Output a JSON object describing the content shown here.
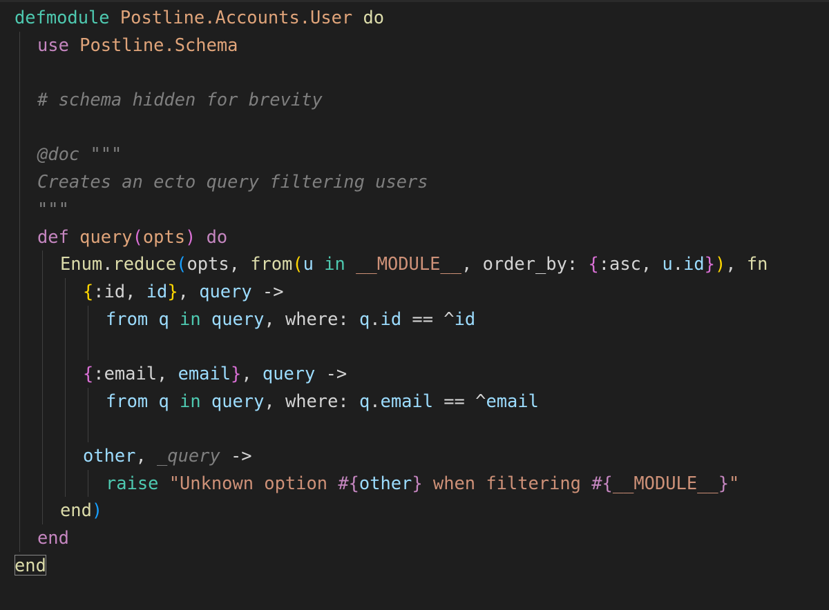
{
  "editor": {
    "lines": [
      {
        "indent": 0,
        "tokens": [
          {
            "t": "defmodule",
            "c": "kw-mod"
          },
          {
            "t": " ",
            "c": "plain"
          },
          {
            "t": "Postline.Accounts.User",
            "c": "mod"
          },
          {
            "t": " ",
            "c": "plain"
          },
          {
            "t": "do",
            "c": "kw-do-top"
          }
        ]
      },
      {
        "indent": 1,
        "tokens": [
          {
            "t": "use",
            "c": "kw"
          },
          {
            "t": " ",
            "c": "plain"
          },
          {
            "t": "Postline.Schema",
            "c": "mod"
          }
        ]
      },
      {
        "indent": 1,
        "tokens": []
      },
      {
        "indent": 1,
        "tokens": [
          {
            "t": "# schema hidden for brevity",
            "c": "comment"
          }
        ]
      },
      {
        "indent": 1,
        "tokens": []
      },
      {
        "indent": 1,
        "tokens": [
          {
            "t": "@doc",
            "c": "comment"
          },
          {
            "t": " \"\"\"",
            "c": "comment"
          }
        ]
      },
      {
        "indent": 1,
        "tokens": [
          {
            "t": "Creates an ecto query filtering users",
            "c": "comment"
          }
        ]
      },
      {
        "indent": 1,
        "tokens": [
          {
            "t": "\"\"\"",
            "c": "comment"
          }
        ]
      },
      {
        "indent": 1,
        "tokens": [
          {
            "t": "def",
            "c": "kw"
          },
          {
            "t": " ",
            "c": "plain"
          },
          {
            "t": "query",
            "c": "mod"
          },
          {
            "t": "(",
            "c": "brace-p"
          },
          {
            "t": "opts",
            "c": "mod"
          },
          {
            "t": ")",
            "c": "brace-p"
          },
          {
            "t": " ",
            "c": "plain"
          },
          {
            "t": "do",
            "c": "kw"
          }
        ]
      },
      {
        "indent": 2,
        "tokens": [
          {
            "t": "Enum",
            "c": "fn"
          },
          {
            "t": ".",
            "c": "plain"
          },
          {
            "t": "reduce",
            "c": "fn"
          },
          {
            "t": "(",
            "c": "brace-b"
          },
          {
            "t": "opts",
            "c": "plain"
          },
          {
            "t": ", ",
            "c": "plain"
          },
          {
            "t": "from",
            "c": "fn"
          },
          {
            "t": "(",
            "c": "brace-y"
          },
          {
            "t": "u",
            "c": "var"
          },
          {
            "t": " ",
            "c": "plain"
          },
          {
            "t": "in",
            "c": "kw-mod"
          },
          {
            "t": " ",
            "c": "plain"
          },
          {
            "t": "__MODULE__",
            "c": "str"
          },
          {
            "t": ", ",
            "c": "plain"
          },
          {
            "t": "order_by:",
            "c": "plain"
          },
          {
            "t": " ",
            "c": "plain"
          },
          {
            "t": "{",
            "c": "brace-p"
          },
          {
            "t": ":asc",
            "c": "plain"
          },
          {
            "t": ", ",
            "c": "plain"
          },
          {
            "t": "u",
            "c": "var"
          },
          {
            "t": ".",
            "c": "plain"
          },
          {
            "t": "id",
            "c": "var"
          },
          {
            "t": "}",
            "c": "brace-p"
          },
          {
            "t": ")",
            "c": "brace-y"
          },
          {
            "t": ", ",
            "c": "plain"
          },
          {
            "t": "fn",
            "c": "fn"
          }
        ]
      },
      {
        "indent": 3,
        "tokens": [
          {
            "t": "{",
            "c": "brace-y"
          },
          {
            "t": ":id",
            "c": "plain"
          },
          {
            "t": ", ",
            "c": "plain"
          },
          {
            "t": "id",
            "c": "var"
          },
          {
            "t": "}",
            "c": "brace-y"
          },
          {
            "t": ", ",
            "c": "plain"
          },
          {
            "t": "query",
            "c": "var"
          },
          {
            "t": " ->",
            "c": "plain"
          }
        ]
      },
      {
        "indent": 4,
        "tokens": [
          {
            "t": "from",
            "c": "var"
          },
          {
            "t": " ",
            "c": "plain"
          },
          {
            "t": "q",
            "c": "var"
          },
          {
            "t": " ",
            "c": "plain"
          },
          {
            "t": "in",
            "c": "kw-mod"
          },
          {
            "t": " ",
            "c": "plain"
          },
          {
            "t": "query",
            "c": "var"
          },
          {
            "t": ", ",
            "c": "plain"
          },
          {
            "t": "where:",
            "c": "plain"
          },
          {
            "t": " ",
            "c": "plain"
          },
          {
            "t": "q",
            "c": "var"
          },
          {
            "t": ".",
            "c": "plain"
          },
          {
            "t": "id",
            "c": "var"
          },
          {
            "t": " == ",
            "c": "plain"
          },
          {
            "t": "^",
            "c": "plain"
          },
          {
            "t": "id",
            "c": "var"
          }
        ]
      },
      {
        "indent": 4,
        "tokens": []
      },
      {
        "indent": 3,
        "tokens": [
          {
            "t": "{",
            "c": "brace-p"
          },
          {
            "t": ":email",
            "c": "plain"
          },
          {
            "t": ", ",
            "c": "plain"
          },
          {
            "t": "email",
            "c": "var"
          },
          {
            "t": "}",
            "c": "brace-p"
          },
          {
            "t": ", ",
            "c": "plain"
          },
          {
            "t": "query",
            "c": "var"
          },
          {
            "t": " ->",
            "c": "plain"
          }
        ]
      },
      {
        "indent": 4,
        "tokens": [
          {
            "t": "from",
            "c": "var"
          },
          {
            "t": " ",
            "c": "plain"
          },
          {
            "t": "q",
            "c": "var"
          },
          {
            "t": " ",
            "c": "plain"
          },
          {
            "t": "in",
            "c": "kw-mod"
          },
          {
            "t": " ",
            "c": "plain"
          },
          {
            "t": "query",
            "c": "var"
          },
          {
            "t": ", ",
            "c": "plain"
          },
          {
            "t": "where:",
            "c": "plain"
          },
          {
            "t": " ",
            "c": "plain"
          },
          {
            "t": "q",
            "c": "var"
          },
          {
            "t": ".",
            "c": "plain"
          },
          {
            "t": "email",
            "c": "var"
          },
          {
            "t": " == ",
            "c": "plain"
          },
          {
            "t": "^",
            "c": "plain"
          },
          {
            "t": "email",
            "c": "var"
          }
        ]
      },
      {
        "indent": 4,
        "tokens": []
      },
      {
        "indent": 3,
        "tokens": [
          {
            "t": "other",
            "c": "var"
          },
          {
            "t": ", ",
            "c": "plain"
          },
          {
            "t": "_query",
            "c": "dim-italic"
          },
          {
            "t": " ->",
            "c": "plain"
          }
        ]
      },
      {
        "indent": 4,
        "tokens": [
          {
            "t": "raise",
            "c": "kw-mod"
          },
          {
            "t": " ",
            "c": "plain"
          },
          {
            "t": "\"Unknown option ",
            "c": "str"
          },
          {
            "t": "#{",
            "c": "purple"
          },
          {
            "t": "other",
            "c": "var"
          },
          {
            "t": "}",
            "c": "purple"
          },
          {
            "t": " when filtering ",
            "c": "str"
          },
          {
            "t": "#{",
            "c": "purple"
          },
          {
            "t": "__MODULE__",
            "c": "str"
          },
          {
            "t": "}",
            "c": "purple"
          },
          {
            "t": "\"",
            "c": "str"
          }
        ]
      },
      {
        "indent": 2,
        "tokens": [
          {
            "t": "end",
            "c": "fn"
          },
          {
            "t": ")",
            "c": "brace-b"
          }
        ]
      },
      {
        "indent": 1,
        "tokens": [
          {
            "t": "end",
            "c": "kw"
          }
        ]
      },
      {
        "indent": 0,
        "tokens": [
          {
            "t": "end",
            "c": "kw-do-top",
            "cursor": true
          }
        ]
      }
    ],
    "colors": {
      "background": "#1e1e1e",
      "guide": "#404040"
    }
  }
}
